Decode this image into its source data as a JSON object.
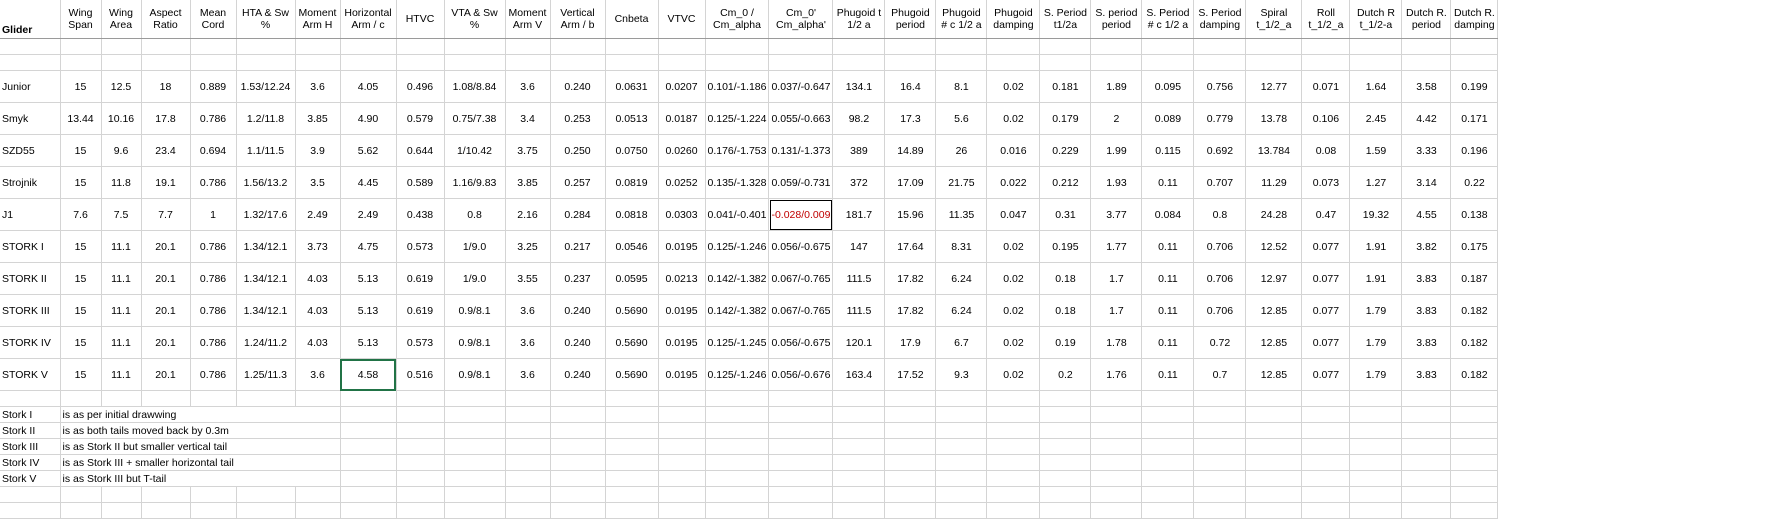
{
  "sheet": {
    "headers": [
      [
        "Glider"
      ],
      [
        "Wing",
        "Span"
      ],
      [
        "Wing",
        "Area"
      ],
      [
        "Aspect",
        "Ratio"
      ],
      [
        "Mean",
        "Cord"
      ],
      [
        "HTA & Sw",
        "%"
      ],
      [
        "Moment",
        "Arm H"
      ],
      [
        "Horizontal",
        "Arm / c"
      ],
      [
        "HTVC"
      ],
      [
        "VTA & Sw",
        "%"
      ],
      [
        "Moment",
        "Arm V"
      ],
      [
        "Vertical",
        "Arm / b"
      ],
      [
        "Cnbeta"
      ],
      [
        "VTVC"
      ],
      [
        "Cm_0 /",
        "Cm_alpha"
      ],
      [
        "Cm_0'",
        "Cm_alpha'"
      ],
      [
        "Phugoid t",
        "1/2 a"
      ],
      [
        "Phugoid",
        "period"
      ],
      [
        "Phugoid",
        "# c 1/2 a"
      ],
      [
        "Phugoid",
        "damping"
      ],
      [
        "S. Period",
        "t1/2a"
      ],
      [
        "S. period",
        "period"
      ],
      [
        "S. Period",
        "# c 1/2 a"
      ],
      [
        "S. Period",
        "damping"
      ],
      [
        "Spiral",
        "t_1/2_a"
      ],
      [
        "Roll",
        "t_1/2_a"
      ],
      [
        "Dutch R",
        "t_1/2-a"
      ],
      [
        "Dutch R.",
        "period"
      ],
      [
        "Dutch R.",
        "damping"
      ]
    ],
    "rows": [
      [
        "Junior",
        "15",
        "12.5",
        "18",
        "0.889",
        "1.53/12.24",
        "3.6",
        "4.05",
        "0.496",
        "1.08/8.84",
        "3.6",
        "0.240",
        "0.0631",
        "0.0207",
        "0.101/-1.186",
        "0.037/-0.647",
        "134.1",
        "16.4",
        "8.1",
        "0.02",
        "0.181",
        "1.89",
        "0.095",
        "0.756",
        "12.77",
        "0.071",
        "1.64",
        "3.58",
        "0.199"
      ],
      [
        "Smyk",
        "13.44",
        "10.16",
        "17.8",
        "0.786",
        "1.2/11.8",
        "3.85",
        "4.90",
        "0.579",
        "0.75/7.38",
        "3.4",
        "0.253",
        "0.0513",
        "0.0187",
        "0.125/-1.224",
        "0.055/-0.663",
        "98.2",
        "17.3",
        "5.6",
        "0.02",
        "0.179",
        "2",
        "0.089",
        "0.779",
        "13.78",
        "0.106",
        "2.45",
        "4.42",
        "0.171"
      ],
      [
        "SZD55",
        "15",
        "9.6",
        "23.4",
        "0.694",
        "1.1/11.5",
        "3.9",
        "5.62",
        "0.644",
        "1/10.42",
        "3.75",
        "0.250",
        "0.0750",
        "0.0260",
        "0.176/-1.753",
        "0.131/-1.373",
        "389",
        "14.89",
        "26",
        "0.016",
        "0.229",
        "1.99",
        "0.115",
        "0.692",
        "13.784",
        "0.08",
        "1.59",
        "3.33",
        "0.196"
      ],
      [
        "Strojnik",
        "15",
        "11.8",
        "19.1",
        "0.786",
        "1.56/13.2",
        "3.5",
        "4.45",
        "0.589",
        "1.16/9.83",
        "3.85",
        "0.257",
        "0.0819",
        "0.0252",
        "0.135/-1.328",
        "0.059/-0.731",
        "372",
        "17.09",
        "21.75",
        "0.022",
        "0.212",
        "1.93",
        "0.11",
        "0.707",
        "11.29",
        "0.073",
        "1.27",
        "3.14",
        "0.22"
      ],
      [
        "J1",
        "7.6",
        "7.5",
        "7.7",
        "1",
        "1.32/17.6",
        "2.49",
        "2.49",
        "0.438",
        "0.8",
        "2.16",
        "0.284",
        "0.0818",
        "0.0303",
        "0.041/-0.401",
        "-0.028/0.009",
        "181.7",
        "15.96",
        "11.35",
        "0.047",
        "0.31",
        "3.77",
        "0.084",
        "0.8",
        "24.28",
        "0.47",
        "19.32",
        "4.55",
        "0.138"
      ],
      [
        "STORK I",
        "15",
        "11.1",
        "20.1",
        "0.786",
        "1.34/12.1",
        "3.73",
        "4.75",
        "0.573",
        "1/9.0",
        "3.25",
        "0.217",
        "0.0546",
        "0.0195",
        "0.125/-1.246",
        "0.056/-0.675",
        "147",
        "17.64",
        "8.31",
        "0.02",
        "0.195",
        "1.77",
        "0.11",
        "0.706",
        "12.52",
        "0.077",
        "1.91",
        "3.82",
        "0.175"
      ],
      [
        "STORK II",
        "15",
        "11.1",
        "20.1",
        "0.786",
        "1.34/12.1",
        "4.03",
        "5.13",
        "0.619",
        "1/9.0",
        "3.55",
        "0.237",
        "0.0595",
        "0.0213",
        "0.142/-1.382",
        "0.067/-0.765",
        "111.5",
        "17.82",
        "6.24",
        "0.02",
        "0.18",
        "1.7",
        "0.11",
        "0.706",
        "12.97",
        "0.077",
        "1.91",
        "3.83",
        "0.187"
      ],
      [
        "STORK III",
        "15",
        "11.1",
        "20.1",
        "0.786",
        "1.34/12.1",
        "4.03",
        "5.13",
        "0.619",
        "0.9/8.1",
        "3.6",
        "0.240",
        "0.5690",
        "0.0195",
        "0.142/-1.382",
        "0.067/-0.765",
        "111.5",
        "17.82",
        "6.24",
        "0.02",
        "0.18",
        "1.7",
        "0.11",
        "0.706",
        "12.85",
        "0.077",
        "1.79",
        "3.83",
        "0.182"
      ],
      [
        "STORK IV",
        "15",
        "11.1",
        "20.1",
        "0.786",
        "1.24/11.2",
        "4.03",
        "5.13",
        "0.573",
        "0.9/8.1",
        "3.6",
        "0.240",
        "0.5690",
        "0.0195",
        "0.125/-1.245",
        "0.056/-0.675",
        "120.1",
        "17.9",
        "6.7",
        "0.02",
        "0.19",
        "1.78",
        "0.11",
        "0.72",
        "12.85",
        "0.077",
        "1.79",
        "3.83",
        "0.182"
      ],
      [
        "STORK V",
        "15",
        "11.1",
        "20.1",
        "0.786",
        "1.25/11.3",
        "3.6",
        "4.58",
        "0.516",
        "0.9/8.1",
        "3.6",
        "0.240",
        "0.5690",
        "0.0195",
        "0.125/-1.246",
        "0.056/-0.676",
        "163.4",
        "17.52",
        "9.3",
        "0.02",
        "0.2",
        "1.76",
        "0.11",
        "0.7",
        "12.85",
        "0.077",
        "1.79",
        "3.83",
        "0.182"
      ]
    ],
    "notes": [
      [
        "Stork I",
        "is as per initial drawwing"
      ],
      [
        "Stork II",
        "is as both tails moved back by 0.3m"
      ],
      [
        "Stork III",
        "is as Stork II but smaller vertical tail"
      ],
      [
        "Stork IV",
        "is as Stork III + smaller horizontal tail"
      ],
      [
        "Stork V",
        "is as Stork III but T-tail"
      ]
    ],
    "selected_cell_color": "#217346",
    "highlight_text_color": "#c00000"
  }
}
